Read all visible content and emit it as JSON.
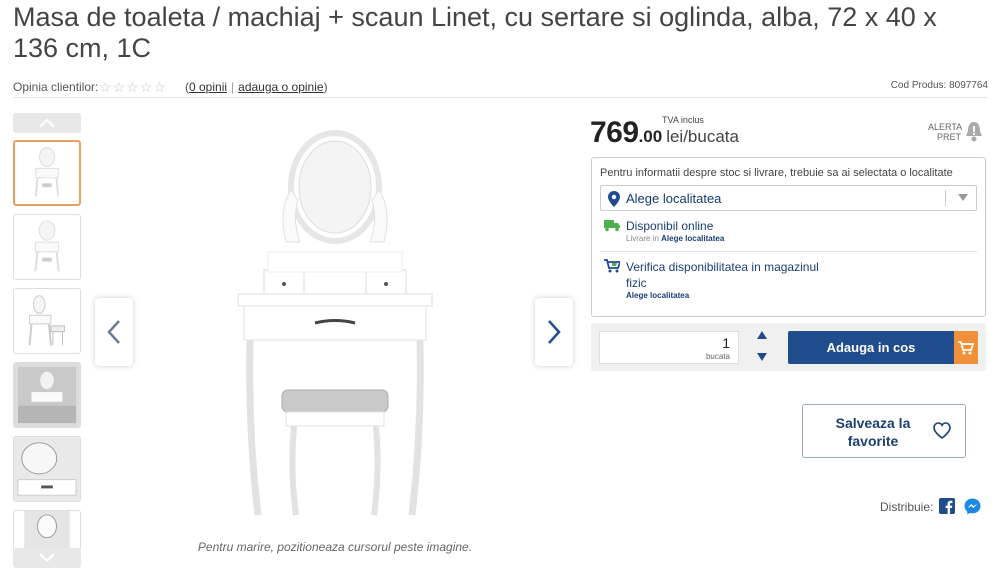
{
  "product": {
    "title": "Masa de toaleta / machiaj + scaun Linet, cu sertare si oglinda, alba, 72 x 40 x 136 cm, 1C",
    "rating_label": "Opinia clientilor:",
    "stars_filled": 0,
    "stars_total": 5,
    "opinions_link": "0 opinii",
    "add_opinion_link": "adauga o opinie",
    "product_code": "Cod Produs: 8097764"
  },
  "gallery": {
    "caption": "Pentru marire, pozitioneaza cursorul peste imagine.",
    "thumbnails": [
      "thumb-1",
      "thumb-2",
      "thumb-3",
      "thumb-4",
      "thumb-5",
      "thumb-6"
    ],
    "active_index": 0
  },
  "price": {
    "tva_label": "TVA inclus",
    "integer": "769",
    "decimal": ".00",
    "unit": "lei/bucata",
    "alert_label_1": "ALERTA",
    "alert_label_2": "PRET"
  },
  "stock": {
    "info": "Pentru informatii despre stoc si livrare, trebuie sa ai selectata o localitate",
    "location_value": "Alege localitatea",
    "online_title": "Disponibil online",
    "online_sub_prefix": "Livrare in",
    "online_sub_link": "Alege localitatea",
    "store_title_1": "Verifica disponibilitatea in magazinul",
    "store_title_2": "fizic",
    "store_sub_link": "Alege localitatea"
  },
  "cart": {
    "quantity": "1",
    "quantity_unit": "bucata",
    "add_label": "Adauga in cos"
  },
  "favorite": {
    "label_1": "Salveaza la",
    "label_2": "favorite"
  },
  "share": {
    "label": "Distribuie:"
  },
  "colors": {
    "primary": "#1f4c8c",
    "accent": "#f0913a",
    "active_thumb_border": "#e8a060"
  },
  "icons": [
    "star-icon",
    "chevron-up-icon",
    "chevron-down-icon",
    "chevron-left-icon",
    "chevron-right-icon",
    "bell-icon",
    "map-pin-icon",
    "truck-icon",
    "store-cart-icon",
    "cart-icon",
    "heart-icon",
    "facebook-icon",
    "messenger-icon"
  ]
}
